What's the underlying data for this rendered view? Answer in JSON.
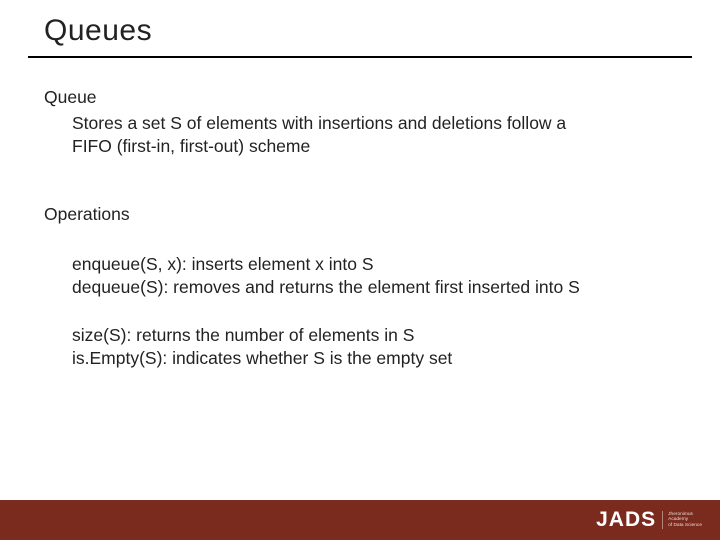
{
  "title": "Queues",
  "body": {
    "queue_head": "Queue",
    "queue_line1": "Stores a set S of elements with insertions and deletions follow a",
    "queue_line2": "FIFO (first-in, first-out) scheme",
    "ops_head": "Operations",
    "op_enqueue": "enqueue(S, x): inserts element x into S",
    "op_dequeue": "dequeue(S): removes and returns the element first inserted into S",
    "op_size": "size(S): returns the number of elements in S",
    "op_isempty": "is.Empty(S): indicates whether S is the empty set"
  },
  "footer": {
    "logo_text": "JADS",
    "logo_tag_1": "Jheronimus",
    "logo_tag_2": "Academy",
    "logo_tag_3": "of Data Science"
  }
}
